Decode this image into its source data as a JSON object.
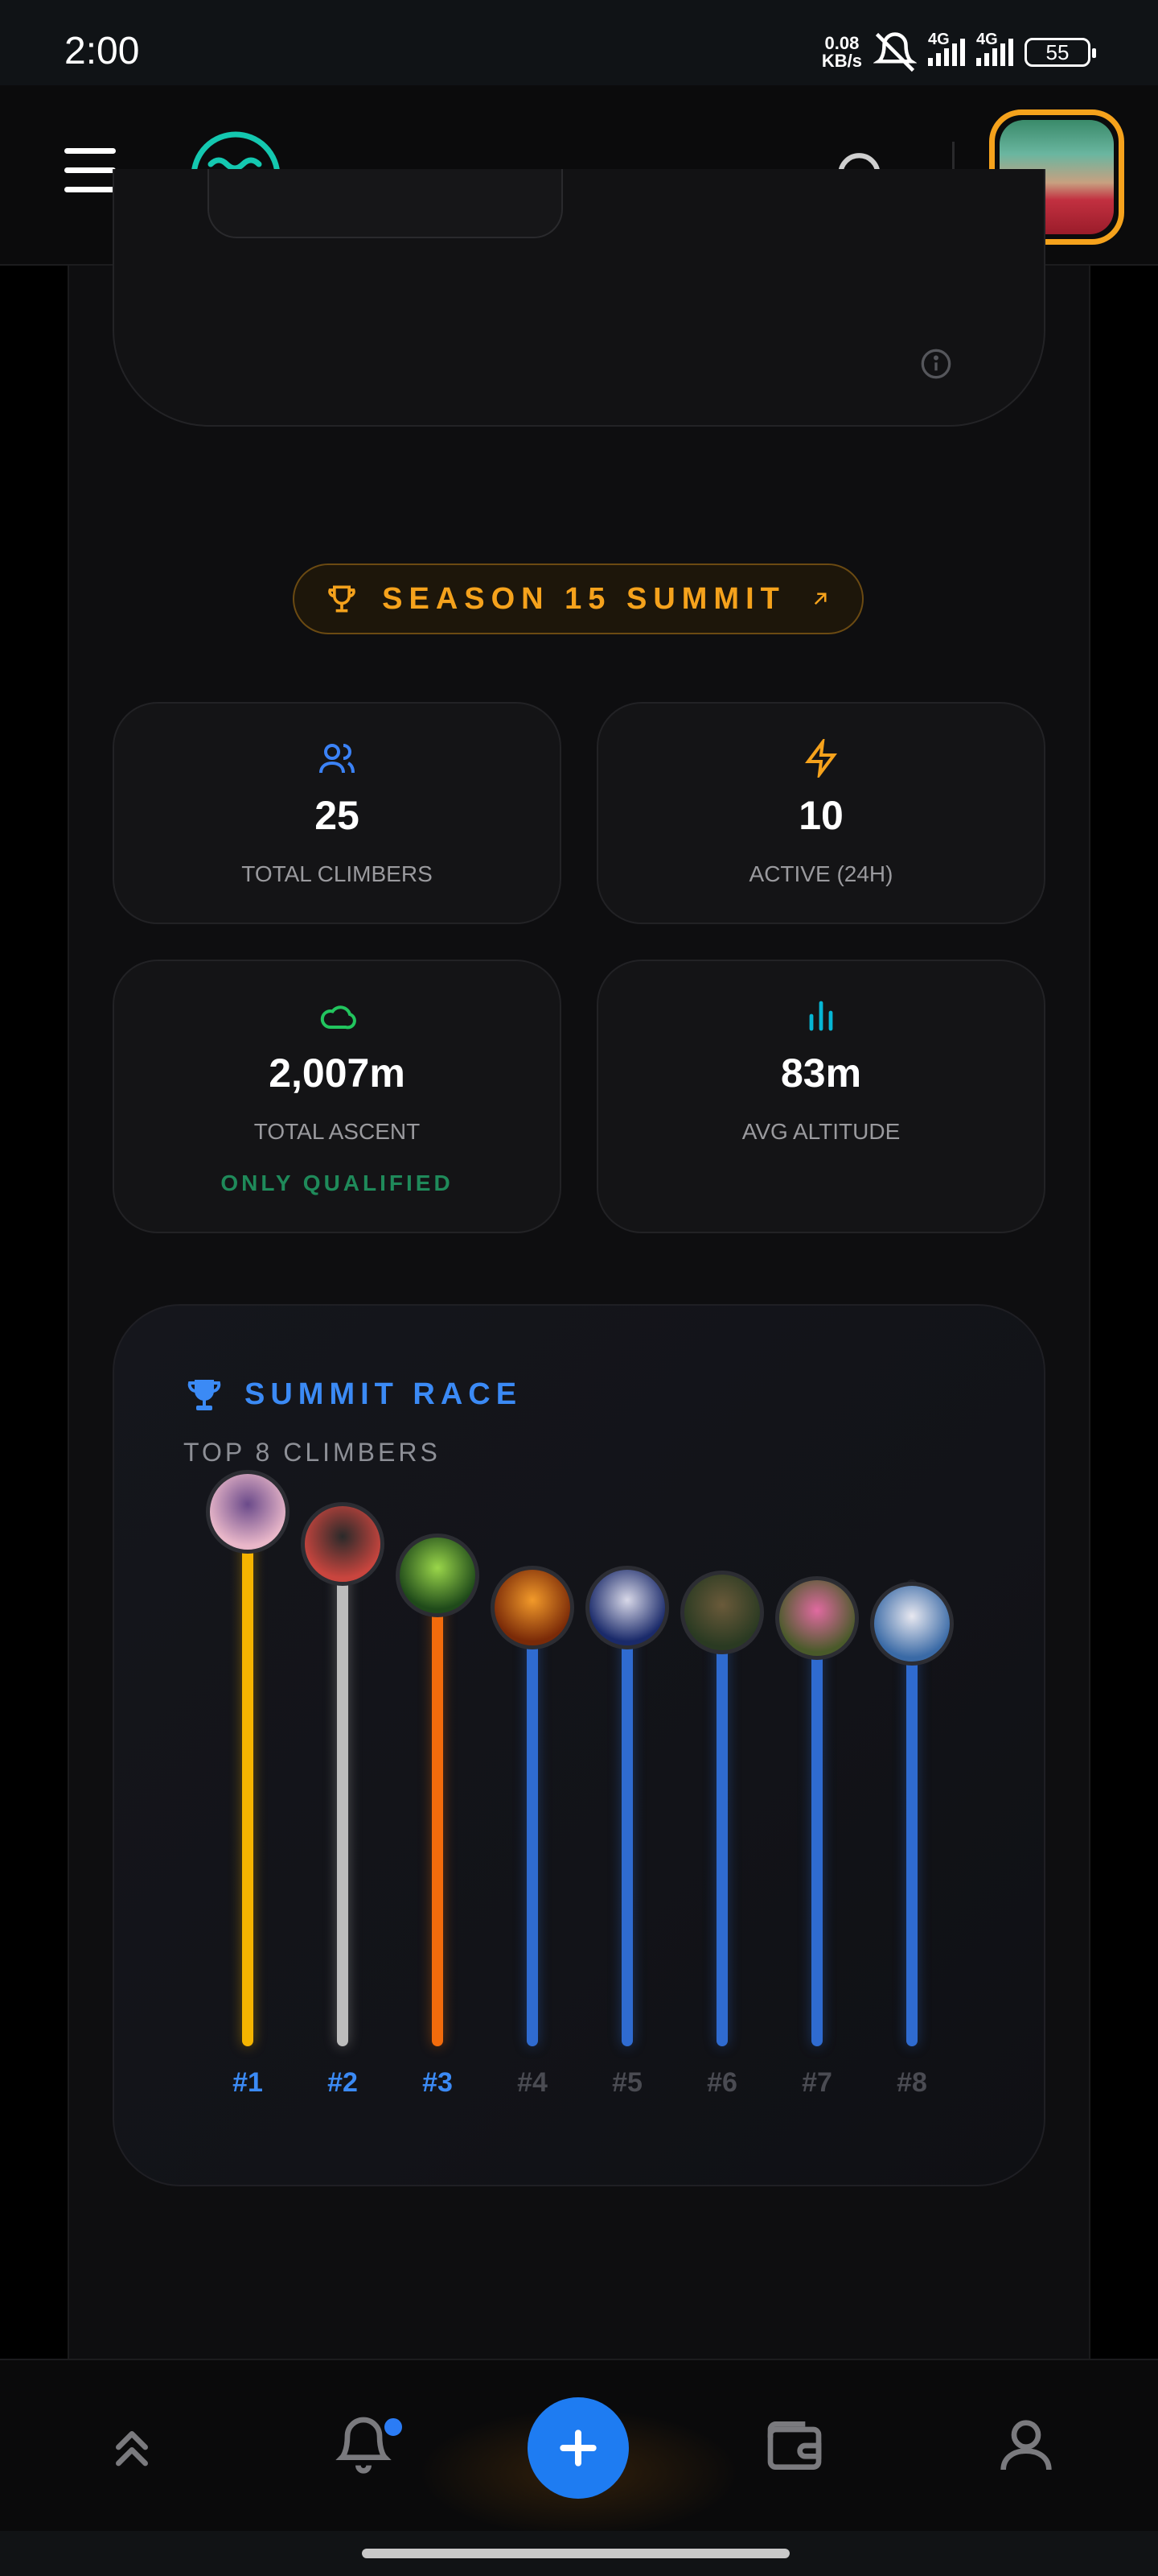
{
  "status_bar": {
    "time": "2:00",
    "net_speed_value": "0.08",
    "net_speed_unit": "KB/s",
    "network_1": "4G",
    "network_2": "4G",
    "battery": "55"
  },
  "header": {
    "menu_icon": "hamburger-icon",
    "logo_icon": "waves-logo",
    "search_icon": "search-icon"
  },
  "season": {
    "label": "SEASON 15 SUMMIT",
    "color": "#f5a21c"
  },
  "stats": [
    {
      "icon": "users-icon",
      "value": "25",
      "label": "TOTAL CLIMBERS",
      "color": "#3b82f6"
    },
    {
      "icon": "lightning-icon",
      "value": "10",
      "label": "ACTIVE (24H)",
      "color": "#f5a21c"
    },
    {
      "icon": "cloud-icon",
      "value": "2,007m",
      "label": "TOTAL ASCENT",
      "sublabel": "ONLY QUALIFIED",
      "color": "#22c55e"
    },
    {
      "icon": "bar-chart-icon",
      "value": "83m",
      "label": "AVG ALTITUDE",
      "color": "#06b6d4"
    }
  ],
  "race": {
    "title": "SUMMIT RACE",
    "subtitle": "TOP 8 CLIMBERS",
    "accent": "#3b8af5",
    "climbers": [
      {
        "rank": "#1",
        "level": 1.0,
        "color": "#f5b400"
      },
      {
        "rank": "#2",
        "level": 0.94,
        "color": "#bcbcbc"
      },
      {
        "rank": "#3",
        "level": 0.88,
        "color": "#f26b0c"
      },
      {
        "rank": "#4",
        "level": 0.82,
        "color": "#2f6bd0"
      },
      {
        "rank": "#5",
        "level": 0.82,
        "color": "#2f6bd0"
      },
      {
        "rank": "#6",
        "level": 0.81,
        "color": "#2f6bd0"
      },
      {
        "rank": "#7",
        "level": 0.8,
        "color": "#2f6bd0"
      },
      {
        "rank": "#8",
        "level": 0.79,
        "color": "#2f6bd0"
      }
    ]
  },
  "bottom_nav": {
    "items": [
      "chevrons-up-icon",
      "bell-icon",
      "plus-icon",
      "wallet-icon",
      "user-icon"
    ],
    "fab_color": "#1e7cf2"
  }
}
